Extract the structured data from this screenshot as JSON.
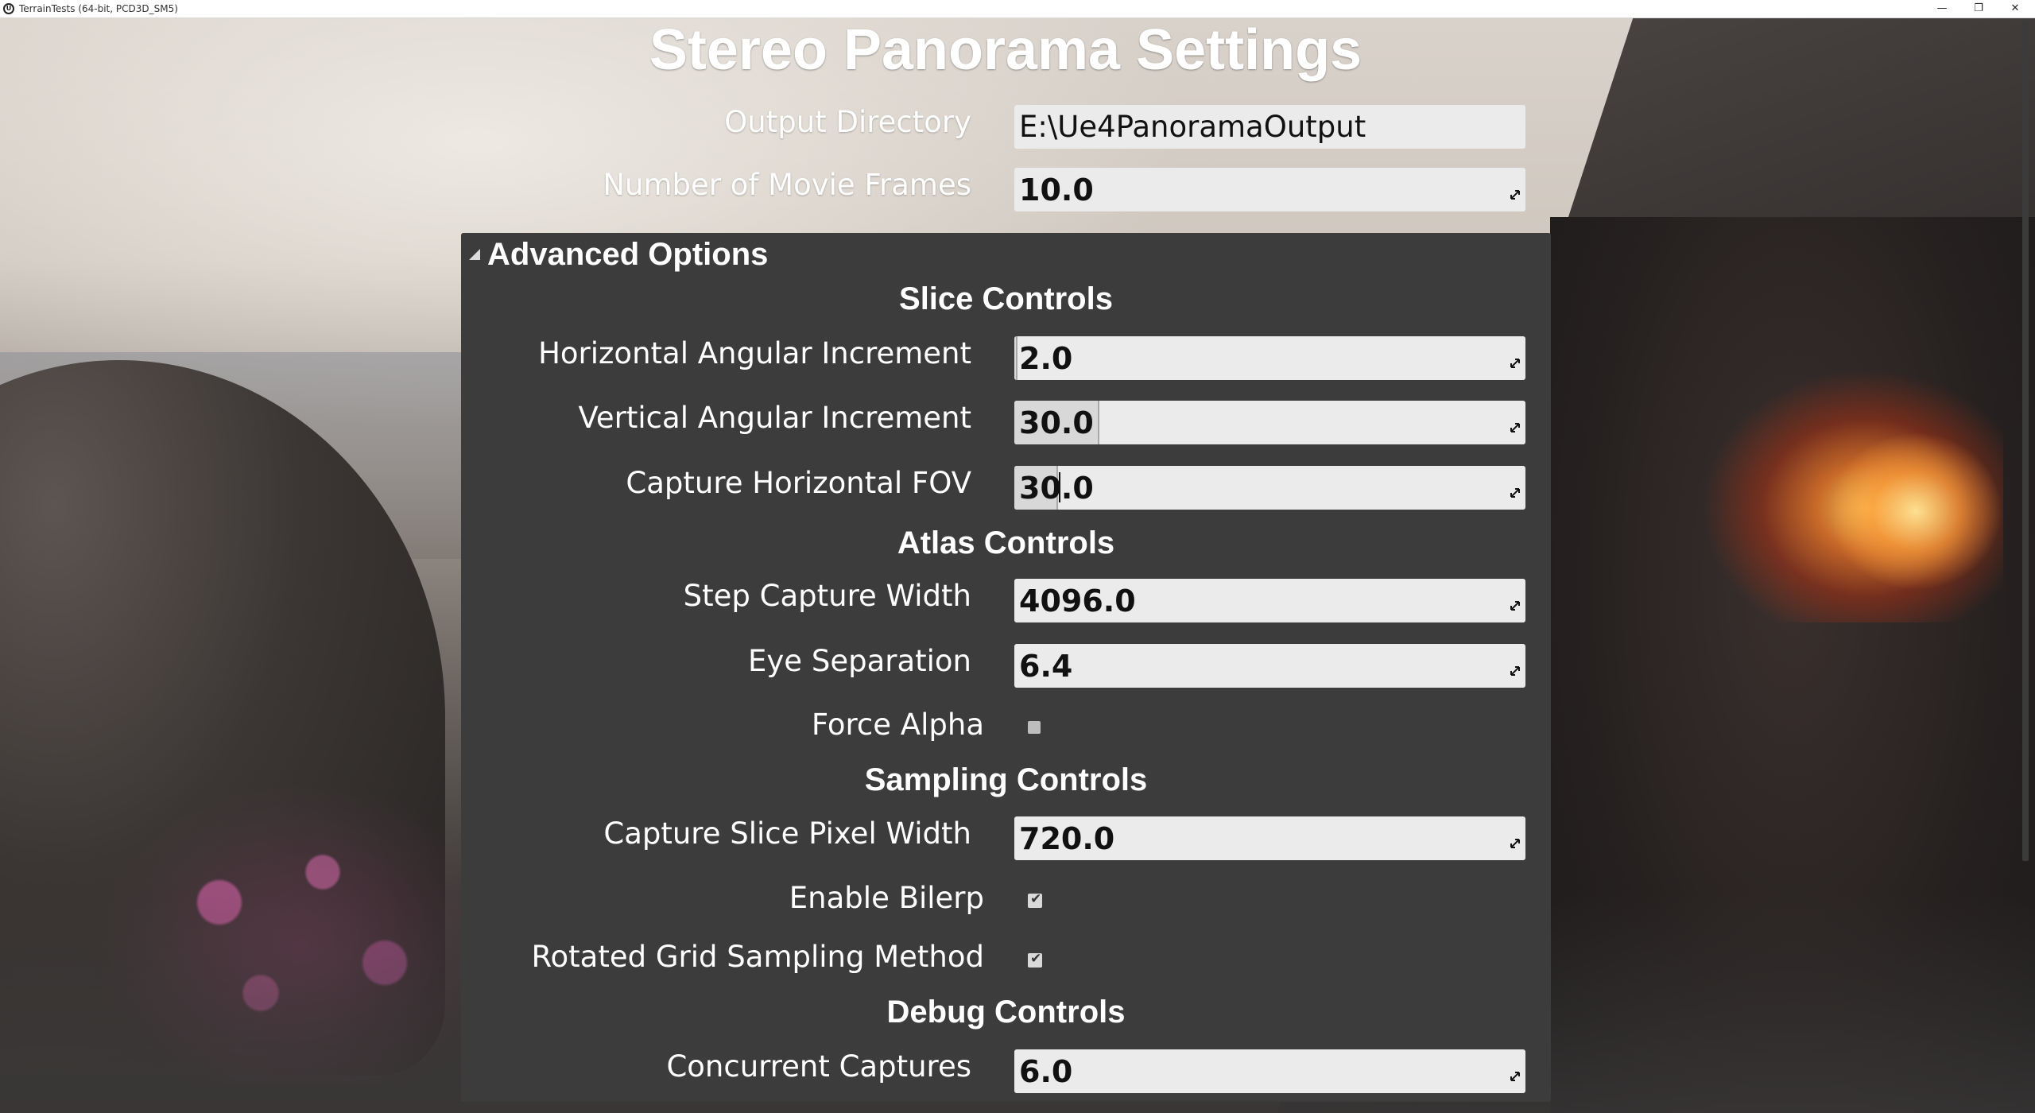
{
  "window": {
    "title": "TerrainTests (64-bit, PCD3D_SM5)",
    "app_icon": "ue4-logo-icon",
    "controls": {
      "minimize": "—",
      "maximize": "❐",
      "close": "✕"
    }
  },
  "page": {
    "title": "Stereo Panorama Settings"
  },
  "general": {
    "output_directory": {
      "label": "Output Directory",
      "value": "E:\\Ue4PanoramaOutput"
    },
    "movie_frames": {
      "label": "Number of Movie Frames",
      "value": "10.0"
    }
  },
  "advanced": {
    "header": "Advanced Options",
    "slice_controls": {
      "title": "Slice Controls",
      "horizontal_angular_increment": {
        "label": "Horizontal Angular Increment",
        "value": "2.0"
      },
      "vertical_angular_increment": {
        "label": "Vertical Angular Increment",
        "value": "30.0"
      },
      "capture_horizontal_fov": {
        "label": "Capture Horizontal FOV",
        "value": "30.0"
      }
    },
    "atlas_controls": {
      "title": "Atlas Controls",
      "step_capture_width": {
        "label": "Step Capture Width",
        "value": "4096.0"
      },
      "eye_separation": {
        "label": "Eye Separation",
        "value": "6.4"
      },
      "force_alpha": {
        "label": "Force Alpha",
        "checked": false
      }
    },
    "sampling_controls": {
      "title": "Sampling Controls",
      "capture_slice_pixel_width": {
        "label": "Capture Slice Pixel Width",
        "value": "720.0"
      },
      "enable_bilerp": {
        "label": "Enable Bilerp",
        "checked": true,
        "mark": "✔"
      },
      "rotated_grid_sampling": {
        "label": "Rotated Grid Sampling Method",
        "checked": true,
        "mark": "✔"
      }
    },
    "debug_controls": {
      "title": "Debug Controls",
      "concurrent_captures": {
        "label": "Concurrent Captures",
        "value": "6.0"
      }
    }
  }
}
